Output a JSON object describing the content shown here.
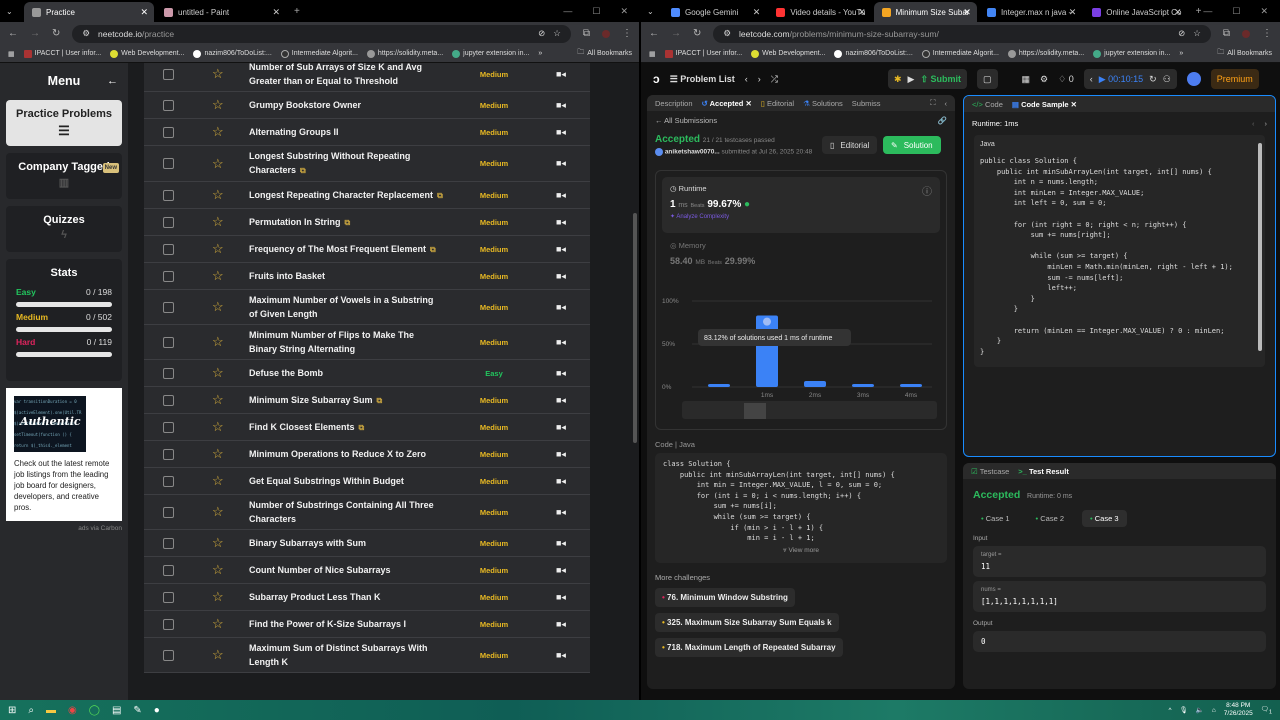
{
  "left_browser": {
    "tabs": [
      {
        "label": "Practice",
        "active": true
      },
      {
        "label": "untitled - Paint",
        "active": false
      }
    ],
    "url_host": "neetcode.io",
    "url_path": "/practice",
    "bookmarks": [
      "IPACCT | User infor...",
      "Web Development...",
      "nazim806/ToDoList:...",
      "Intermediate Algorit...",
      "https://solidity.meta...",
      "jupyter extension in...",
      "All Bookmarks"
    ],
    "sidebar": {
      "title": "Menu",
      "items": [
        {
          "label": "Practice Problems"
        },
        {
          "label": "Company Tagged",
          "badge": "New"
        },
        {
          "label": "Quizzes"
        }
      ],
      "stats": {
        "title": "Stats",
        "rows": [
          {
            "label": "Easy",
            "value": "0 / 198",
            "color": "#22c55e"
          },
          {
            "label": "Medium",
            "value": "0 / 502",
            "color": "#e8b923"
          },
          {
            "label": "Hard",
            "value": "0 / 119",
            "color": "#e0245e"
          }
        ]
      },
      "ad": {
        "image_text": "Authentic",
        "text": "Check out the latest remote job listings from the leading job board for designers, developers, and creative pros.",
        "note": "ads via Carbon"
      }
    },
    "problems": [
      {
        "title": "Number of Sub Arrays of Size K and Avg Greater than or Equal to Threshold",
        "difficulty": "Medium"
      },
      {
        "title": "Grumpy Bookstore Owner",
        "difficulty": "Medium"
      },
      {
        "title": "Alternating Groups II",
        "difficulty": "Medium"
      },
      {
        "title": "Longest Substring Without Repeating Characters",
        "difficulty": "Medium",
        "ext": true
      },
      {
        "title": "Longest Repeating Character Replacement",
        "difficulty": "Medium",
        "ext": true
      },
      {
        "title": "Permutation In String",
        "difficulty": "Medium",
        "ext": true
      },
      {
        "title": "Frequency of The Most Frequent Element",
        "difficulty": "Medium",
        "ext": true
      },
      {
        "title": "Fruits into Basket",
        "difficulty": "Medium"
      },
      {
        "title": "Maximum Number of Vowels in a Substring of Given Length",
        "difficulty": "Medium"
      },
      {
        "title": "Minimum Number of Flips to Make The Binary String Alternating",
        "difficulty": "Medium"
      },
      {
        "title": "Defuse the Bomb",
        "difficulty": "Easy"
      },
      {
        "title": "Minimum Size Subarray Sum",
        "difficulty": "Medium",
        "ext": true
      },
      {
        "title": "Find K Closest Elements",
        "difficulty": "Medium",
        "ext": true
      },
      {
        "title": "Minimum Operations to Reduce X to Zero",
        "difficulty": "Medium"
      },
      {
        "title": "Get Equal Substrings Within Budget",
        "difficulty": "Medium"
      },
      {
        "title": "Number of Substrings Containing All Three Characters",
        "difficulty": "Medium"
      },
      {
        "title": "Binary Subarrays with Sum",
        "difficulty": "Medium"
      },
      {
        "title": "Count Number of Nice Subarrays",
        "difficulty": "Medium"
      },
      {
        "title": "Subarray Product Less Than K",
        "difficulty": "Medium"
      },
      {
        "title": "Find the Power of K-Size Subarrays I",
        "difficulty": "Medium"
      },
      {
        "title": "Maximum Sum of Distinct Subarrays With Length K",
        "difficulty": "Medium"
      }
    ]
  },
  "right_browser": {
    "tabs": [
      {
        "label": "Google Gemini"
      },
      {
        "label": "Video details - YouTu"
      },
      {
        "label": "Minimum Size Subar",
        "active": true
      },
      {
        "label": "Integer.max n java -"
      },
      {
        "label": "Online JavaScript Co"
      }
    ],
    "url_host": "leetcode.com",
    "url_path": "/problems/minimum-size-subarray-sum/",
    "nav": {
      "problem_list": "Problem List",
      "submit": "Submit",
      "streak": "0",
      "timer": "00:10:15",
      "premium": "Premium"
    },
    "left_tabs": [
      "Description",
      "Accepted",
      "Editorial",
      "Solutions",
      "Submiss"
    ],
    "all_submissions": "All Submissions",
    "result": {
      "status": "Accepted",
      "passed": "21 / 21 testcases passed",
      "user": "aniketshaw0070...",
      "submitted": "submitted at Jul 26, 2025 20:48",
      "editorial_btn": "Editorial",
      "solution_btn": "Solution"
    },
    "runtime": {
      "label": "Runtime",
      "value": "1",
      "unit": "ms",
      "beats_label": "Beats",
      "beats": "99.67%",
      "analyze": "Analyze Complexity"
    },
    "memory": {
      "label": "Memory",
      "value": "58.40",
      "unit": "MB",
      "beats_label": "Beats",
      "beats": "29.99%"
    },
    "distribution": {
      "y_ticks": [
        "100%",
        "50%",
        "0%"
      ],
      "x_labels": [
        "",
        "1ms",
        "2ms",
        "3ms",
        "4ms"
      ],
      "values": [
        2,
        83.12,
        7,
        2,
        2
      ],
      "tooltip": "83.12% of solutions used 1 ms of runtime",
      "highlight": "#3b82f6"
    },
    "code_header": {
      "label": "Code",
      "lang": "Java"
    },
    "submitted_code": [
      "class Solution {",
      "    public int minSubArrayLen(int target, int[] nums) {",
      "        int min = Integer.MAX_VALUE, l = 0, sum = 0;",
      "        for (int i = 0; i < nums.length; i++) {",
      "            sum += nums[i];",
      "            while (sum >= target) {",
      "                if (min > i - l + 1) {",
      "                    min = i - l + 1;"
    ],
    "view_more": "View more",
    "more_challenges": {
      "title": "More challenges",
      "items": [
        {
          "label": "76. Minimum Window Substring",
          "color": "#e0245e"
        },
        {
          "label": "325. Maximum Size Subarray Sum Equals k",
          "color": "#e8b923"
        },
        {
          "label": "718. Maximum Length of Repeated Subarray",
          "color": "#e8b923"
        }
      ]
    },
    "right_tabs": [
      "Code",
      "Code Sample"
    ],
    "sample_runtime": "Runtime: 1ms",
    "sample_lang": "Java",
    "sample_code": [
      "public class Solution {",
      "    public int minSubArrayLen(int target, int[] nums) {",
      "        int n = nums.length;",
      "        int minLen = Integer.MAX_VALUE;",
      "        int left = 0, sum = 0;",
      "",
      "        for (int right = 0; right < n; right++) {",
      "            sum += nums[right];",
      "",
      "            while (sum >= target) {",
      "                minLen = Math.min(minLen, right - left + 1);",
      "                sum -= nums[left];",
      "                left++;",
      "            }",
      "        }",
      "",
      "        return (minLen == Integer.MAX_VALUE) ? 0 : minLen;",
      "    }",
      "}"
    ],
    "test": {
      "tabs": [
        "Testcase",
        "Test Result"
      ],
      "status": "Accepted",
      "runtime": "Runtime: 0 ms",
      "cases": [
        "Case 1",
        "Case 2",
        "Case 3"
      ],
      "input_label": "Input",
      "params": [
        {
          "name": "target =",
          "value": "11"
        },
        {
          "name": "nums =",
          "value": "[1,1,1,1,1,1,1,1]"
        }
      ],
      "output_label": "Output",
      "output": "0"
    }
  },
  "taskbar": {
    "time": "8:48 PM",
    "date": "7/26/2025",
    "notifications": "1"
  }
}
